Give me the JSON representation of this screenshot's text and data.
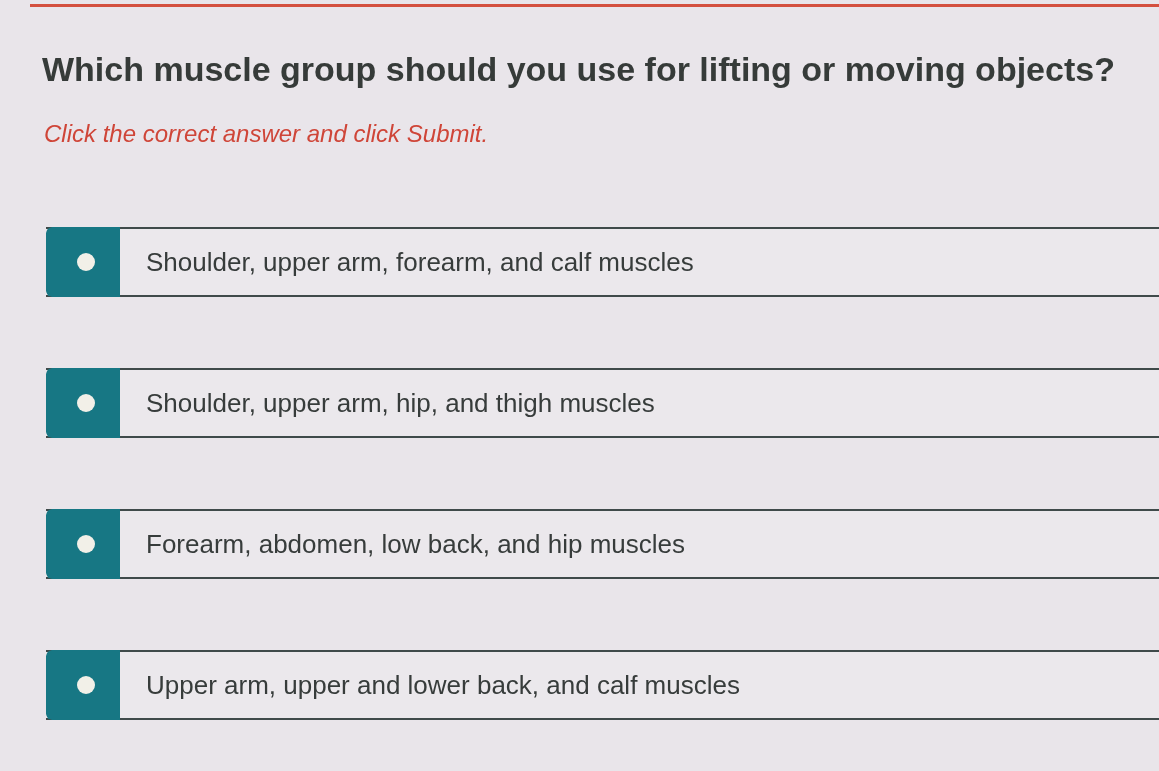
{
  "question": {
    "text": "Which muscle group should you use for lifting or moving objects?",
    "instruction": "Click the correct answer and click Submit."
  },
  "options": [
    {
      "label": "Shoulder, upper arm, forearm, and calf muscles",
      "selected": false
    },
    {
      "label": "Shoulder, upper arm, hip, and thigh muscles",
      "selected": false
    },
    {
      "label": "Forearm, abdomen, low back, and hip muscles",
      "selected": false
    },
    {
      "label": "Upper arm, upper and lower back, and calf muscles",
      "selected": false
    }
  ]
}
